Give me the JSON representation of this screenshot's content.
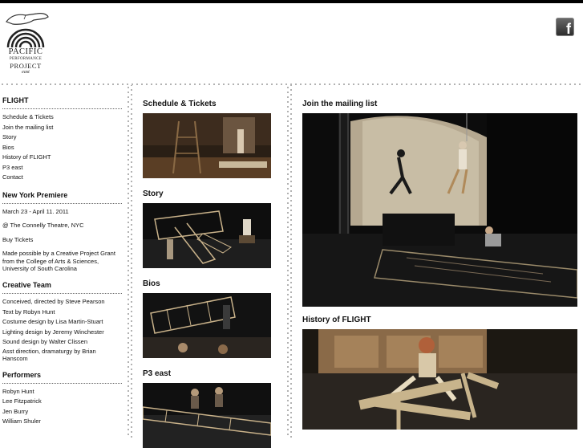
{
  "logo": {
    "line1": "PACIFIC",
    "line2": "PERFORMANCE",
    "line3": "PROJECT",
    "line4": "east"
  },
  "header": {
    "facebook_icon": "facebook-icon",
    "facebook_letter": "f"
  },
  "sidebar": {
    "flight": {
      "title": "FLIGHT",
      "items": [
        {
          "label": "Schedule & Tickets"
        },
        {
          "label": "Join the mailing list"
        },
        {
          "label": "Story"
        },
        {
          "label": "Bios"
        },
        {
          "label": "History of FLIGHT"
        },
        {
          "label": "P3 east"
        },
        {
          "label": "Contact"
        }
      ]
    },
    "premiere": {
      "title": "New York Premiere",
      "dates": "March 23 - April 11. 2011",
      "venue": "@ The Connelly Theatre, NYC",
      "buy": "Buy Tickets",
      "grant": "Made possible by a Creative Project Grant from the College of Arts & Sciences, University of South Carolina"
    },
    "creative": {
      "title": "Creative Team",
      "items": [
        {
          "label": "Conceived, directed by Steve Pearson"
        },
        {
          "label": "Text by Robyn Hunt"
        },
        {
          "label": "Costume design by Lisa Martin-Stuart"
        },
        {
          "label": "Lighting design by Jeremy Winchester"
        },
        {
          "label": "Sound design by Walter Clissen"
        },
        {
          "label": "Asst direction, dramaturgy by Brian Hanscom"
        }
      ]
    },
    "performers": {
      "title": "Performers",
      "items": [
        {
          "label": "Robyn Hunt"
        },
        {
          "label": "Lee Fitzpatrick"
        },
        {
          "label": "Jen Burry"
        },
        {
          "label": "William Shuler"
        }
      ]
    }
  },
  "middle": {
    "sections": [
      {
        "heading": "Schedule & Tickets"
      },
      {
        "heading": "Story"
      },
      {
        "heading": "Bios"
      },
      {
        "heading": "P3 east"
      }
    ]
  },
  "right": {
    "sections": [
      {
        "heading": "Join the mailing list"
      },
      {
        "heading": "History of FLIGHT"
      }
    ]
  }
}
